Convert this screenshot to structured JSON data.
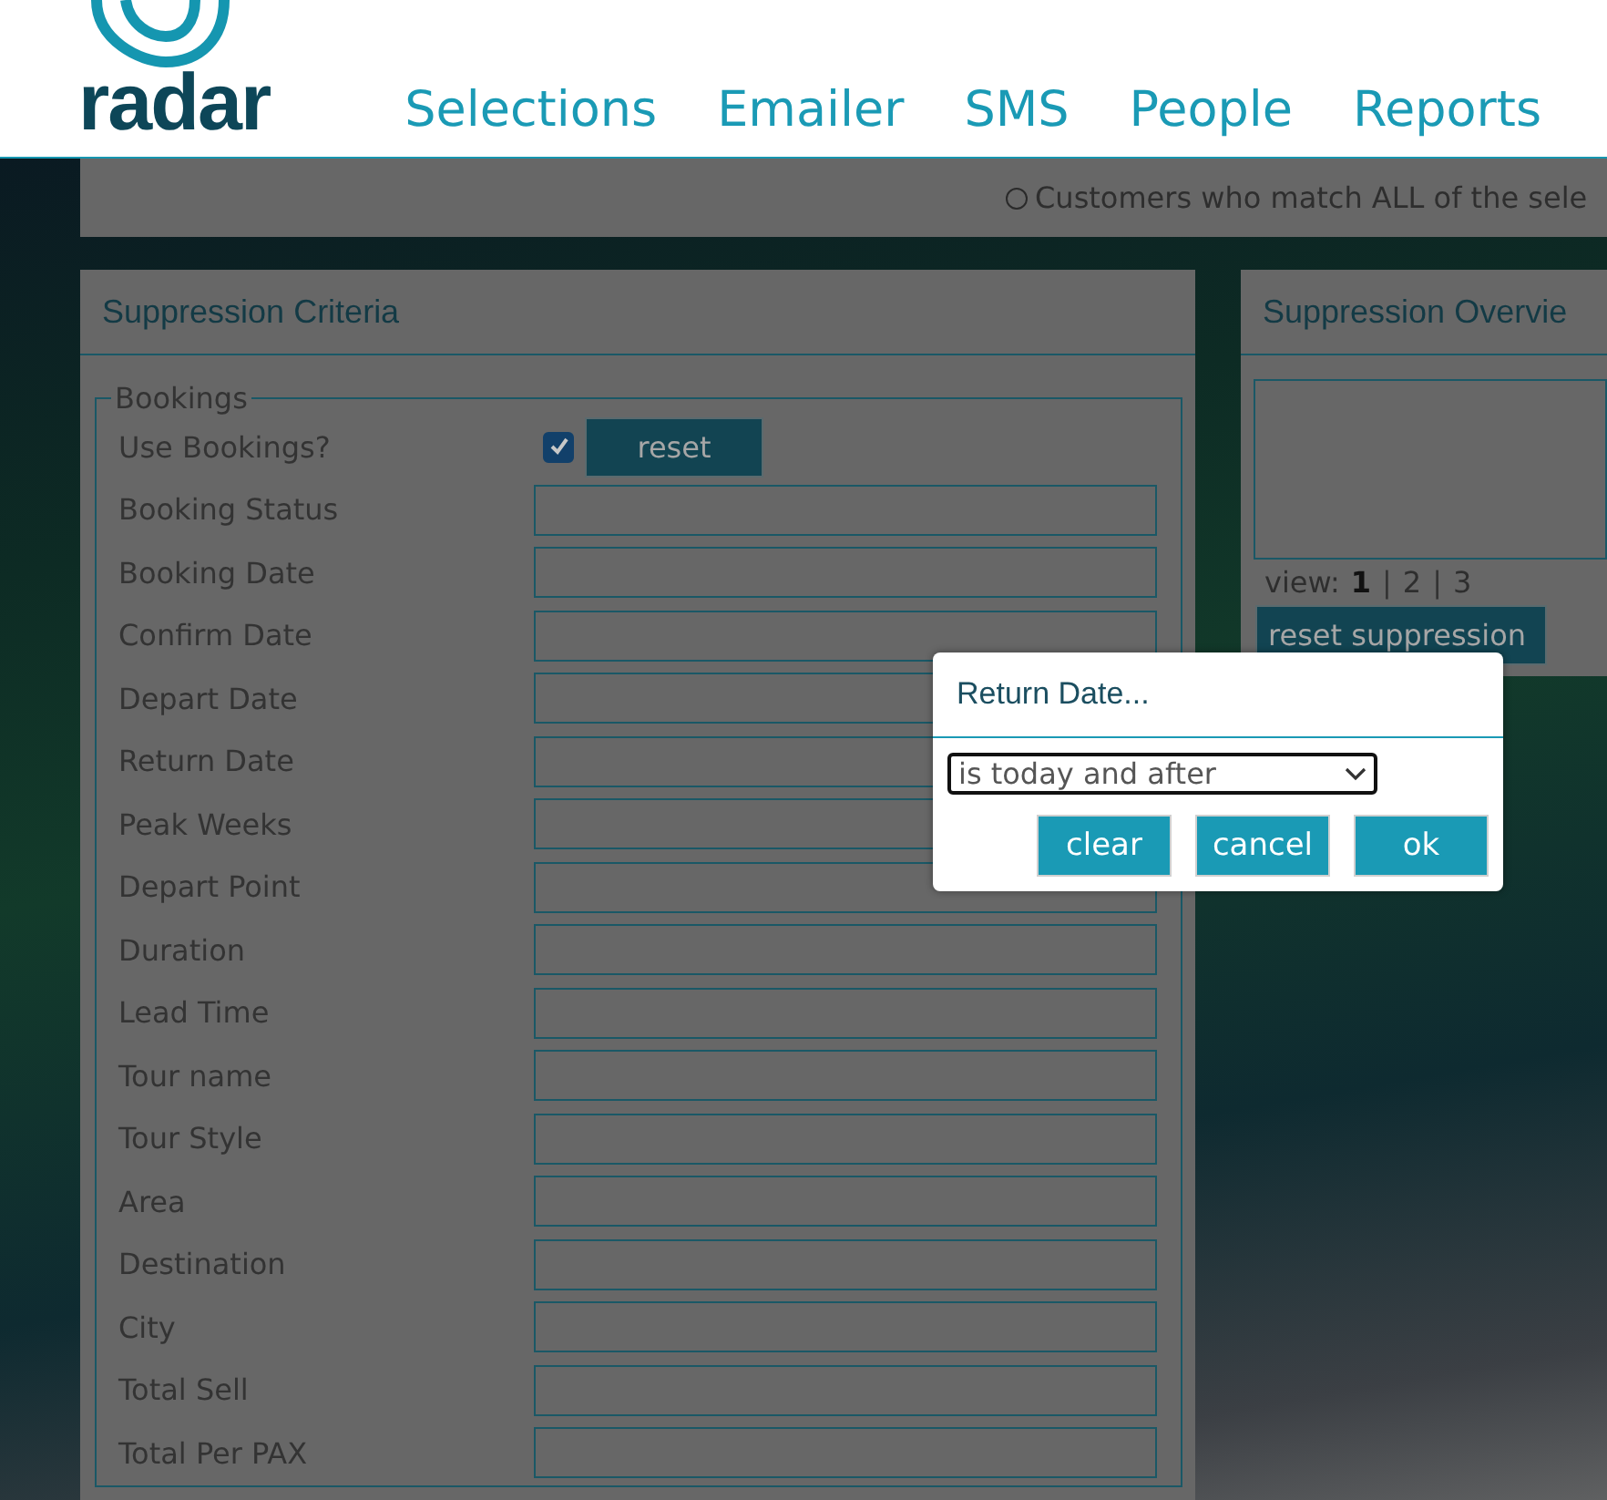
{
  "header": {
    "logo_text": "radar",
    "nav": [
      "Selections",
      "Emailer",
      "SMS",
      "People",
      "Reports"
    ]
  },
  "match_bar": {
    "option": {
      "label": "Customers who match ALL of the sele",
      "selected": false
    }
  },
  "criteria_panel": {
    "title": "Suppression Criteria",
    "legend": "Bookings",
    "use_toggle": {
      "label": "Use Bookings?",
      "checked": true
    },
    "reset_button": "reset",
    "fields": [
      "Booking Status",
      "Booking Date",
      "Confirm Date",
      "Depart Date",
      "Return Date",
      "Peak Weeks",
      "Depart Point",
      "Duration",
      "Lead Time",
      "Tour name",
      "Tour Style",
      "Area",
      "Destination",
      "City",
      "Total Sell",
      "Total Per PAX"
    ]
  },
  "overview_panel": {
    "title": "Suppression Overvie",
    "view_label": "view:",
    "separator": "|",
    "pages": [
      {
        "label": "1",
        "selected": true
      },
      {
        "label": "2",
        "selected": false
      },
      {
        "label": "3",
        "selected": false
      }
    ],
    "reset_button": "reset suppression"
  },
  "dialog": {
    "title": "Return Date...",
    "select": {
      "value": "is today and after"
    },
    "buttons": [
      "clear",
      "cancel",
      "ok"
    ]
  }
}
